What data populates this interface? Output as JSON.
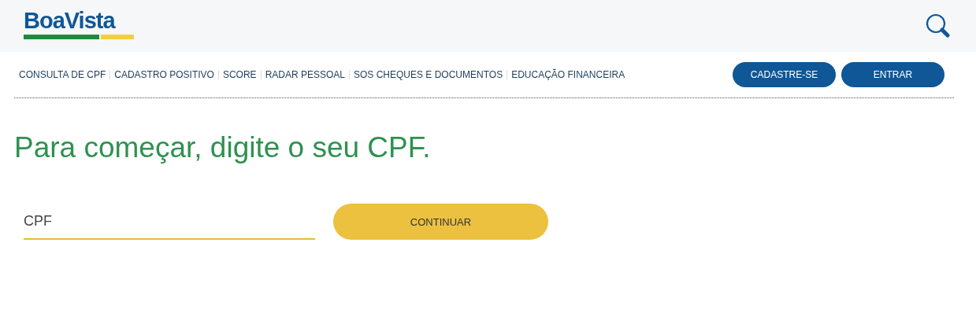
{
  "header": {
    "logo": "BoaVista"
  },
  "nav": {
    "links": [
      "CONSULTA DE CPF",
      "CADASTRO POSITIVO",
      "SCORE",
      "RADAR PESSOAL",
      "SOS CHEQUES E DOCUMENTOS",
      "EDUCAÇÃO FINANCEIRA"
    ],
    "buttons": [
      "CADASTRE-SE",
      "ENTRAR"
    ]
  },
  "heading": "Para começar, digite o seu CPF.",
  "form": {
    "placeholder": "CPF",
    "button": "CONTINUAR"
  }
}
